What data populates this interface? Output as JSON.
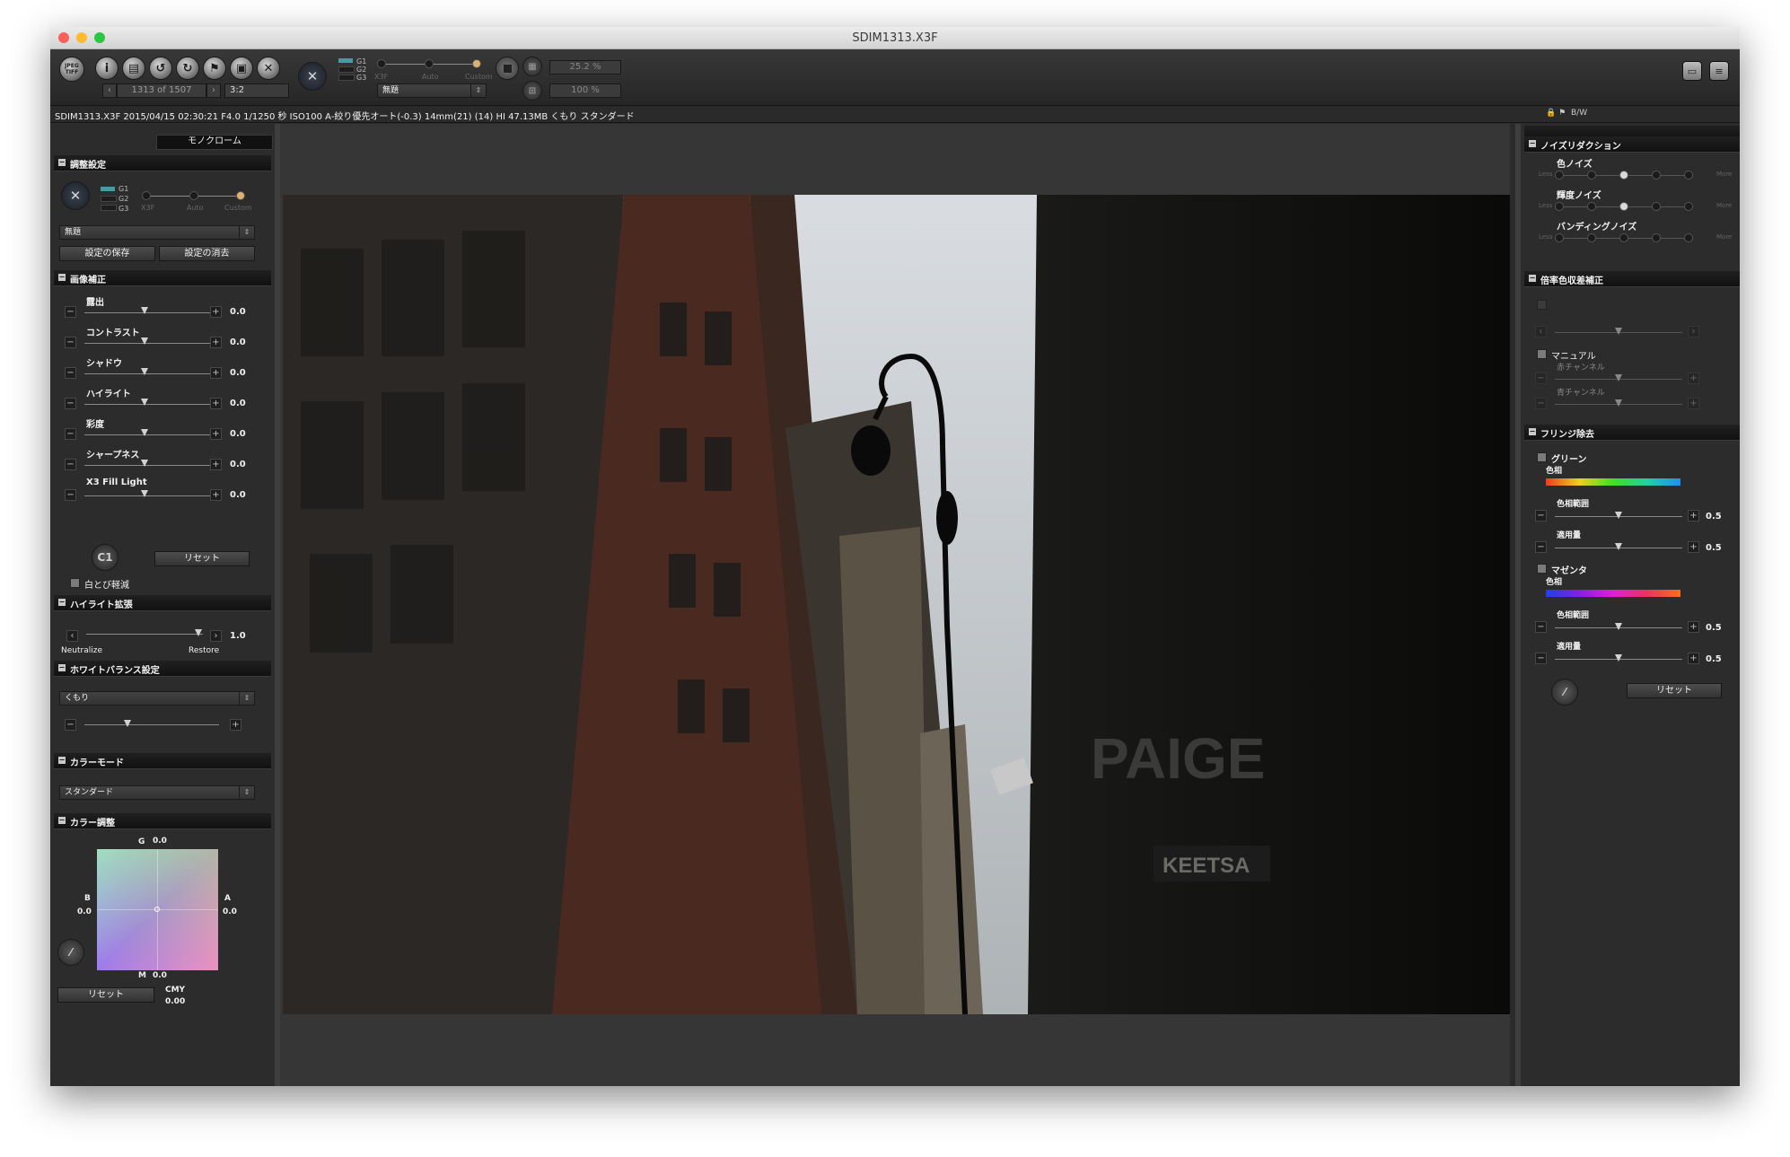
{
  "window": {
    "title": "SDIM1313.X3F"
  },
  "colors": {
    "traffic_red": "#fe5f57",
    "traffic_yellow": "#febb2e",
    "traffic_green": "#29c840",
    "custom_knob": "#e0b070"
  },
  "toolbar": {
    "file_counter": "1313 of 1507",
    "aspect": "3:2",
    "tone_labels": {
      "g1": "G1",
      "g2": "G2",
      "g3": "G3"
    },
    "mode_labels": {
      "x3f": "X3F",
      "auto": "Auto",
      "custom": "Custom"
    },
    "preset": "無題",
    "zoom1": "25.2 %",
    "zoom2": "100 %",
    "icons": [
      "jpeg-tiff-save-icon",
      "info-icon",
      "print-icon",
      "rotate-left-icon",
      "rotate-right-icon",
      "flag-icon",
      "lock-icon",
      "trash-icon",
      "x3f-logo-icon",
      "stop-icon",
      "grid-icon",
      "zoom-fit-icon",
      "compare-icon",
      "list-icon"
    ]
  },
  "infobar": {
    "text": "SDIM1313.X3F 2015/04/15 02:30:21 F4.0 1/1250 秒 ISO100 A-絞り優先オート(-0.3) 14mm(21) (14) HI 47.13MB くもり スタンダード",
    "bw": "B/W"
  },
  "left": {
    "tab": "モノクローム",
    "adjust_section": "調整設定",
    "tones": {
      "g1": "G1",
      "g2": "G2",
      "g3": "G3"
    },
    "modes": {
      "x3f": "X3F",
      "auto": "Auto",
      "custom": "Custom"
    },
    "preset": "無題",
    "save_btn": "設定の保存",
    "delete_btn": "設定の消去",
    "image_section": "画像補正",
    "sliders": [
      {
        "label": "露出",
        "value": "0.0"
      },
      {
        "label": "コントラスト",
        "value": "0.0"
      },
      {
        "label": "シャドウ",
        "value": "0.0"
      },
      {
        "label": "ハイライト",
        "value": "0.0"
      },
      {
        "label": "彩度",
        "value": "0.0"
      },
      {
        "label": "シャープネス",
        "value": "0.0"
      },
      {
        "label": "X3 Fill Light",
        "value": "0.0"
      }
    ],
    "reset": "リセット",
    "white_soft": "白とび軽減",
    "highlight_section": "ハイライト拡張",
    "highlight_value": "1.0",
    "neutralize": "Neutralize",
    "restore": "Restore",
    "wb_section": "ホワイトバランス設定",
    "wb_value": "くもり",
    "color_mode_section": "カラーモード",
    "color_mode_value": "スタンダード",
    "color_adjust_section": "カラー調整",
    "color_wheel": {
      "g": "G",
      "g_val": "0.0",
      "b": "B",
      "b_val": "0.0",
      "a": "A",
      "a_val": "0.0",
      "m": "M",
      "m_val": "0.0"
    },
    "color_reset": "リセット",
    "cmy_label": "CMY",
    "cmy_value": "0.00"
  },
  "right": {
    "noise_section": "ノイズリダクション",
    "color_noise": "色ノイズ",
    "lum_noise": "輝度ノイズ",
    "banding_noise": "バンディングノイズ",
    "less": "Less",
    "more": "More",
    "noise_levels": [
      3,
      3,
      0
    ],
    "chroma_section": "倍率色収差補正",
    "manual": "マニュアル",
    "red_channel": "赤チャンネル",
    "blue_channel": "青チャンネル",
    "fringe_section": "フリンジ除去",
    "green": "グリーン",
    "hue": "色相",
    "hue_range": "色相範囲",
    "amount": "適用量",
    "green_hue_range": "0.5",
    "green_amount": "0.5",
    "magenta": "マゼンタ",
    "magenta_hue_range": "0.5",
    "magenta_amount": "0.5",
    "reset": "リセット"
  },
  "photo": {
    "sign_text": "PAIGE",
    "store_text": "KEETSA"
  }
}
